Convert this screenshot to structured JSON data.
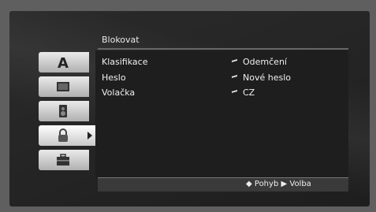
{
  "header": {
    "title": "Blokovat"
  },
  "sidebar": {
    "tabs": [
      {
        "icon": "letter-a-icon"
      },
      {
        "icon": "monitor-icon"
      },
      {
        "icon": "speaker-icon"
      },
      {
        "icon": "lock-icon",
        "active": true
      },
      {
        "icon": "toolbox-icon"
      }
    ]
  },
  "menu": {
    "items": [
      {
        "label": "Klasifikace",
        "value": "Odemčení"
      },
      {
        "label": "Heslo",
        "value": "Nové heslo"
      },
      {
        "label": "Volačka",
        "value": "CZ"
      }
    ]
  },
  "footer": {
    "move_label": "Pohyb",
    "select_label": "Volba"
  }
}
